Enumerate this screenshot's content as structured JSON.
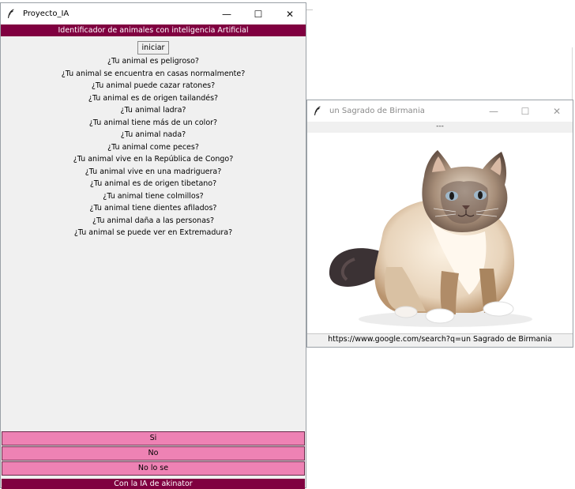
{
  "main_window": {
    "title": "Proyecto_IA",
    "header": "Identificador de animales con inteligencia Artificial",
    "start_label": "iniciar",
    "questions": [
      "¿Tu animal es peligroso?",
      "¿Tu animal se encuentra en casas normalmente?",
      "¿Tu animal puede cazar ratones?",
      "¿Tu animal es de origen tailandés?",
      "¿Tu animal ladra?",
      "¿Tu animal tiene más de un color?",
      "¿Tu animal nada?",
      "¿Tu animal come peces?",
      "¿Tu animal vive en la República de Congo?",
      "¿Tu animal vive en una madriguera?",
      "¿Tu animal es de origen tibetano?",
      "¿Tu animal tiene colmillos?",
      "¿Tu animal tiene dientes afilados?",
      "¿Tu animal daña a las personas?",
      "¿Tu animal se puede ver en Extremadura?"
    ],
    "answers": {
      "yes": "Si",
      "no": "No",
      "dont_know": "No lo se"
    },
    "footer": "Con la IA de akinator"
  },
  "image_window": {
    "title": "un Sagrado de Birmania",
    "top_text": "---",
    "url_text": "https://www.google.com/search?q=un Sagrado de Birmania"
  },
  "window_controls": {
    "minimize": "—",
    "maximize": "☐",
    "close": "✕"
  },
  "colors": {
    "accent": "#800040",
    "answer_button": "#ee82b4",
    "window_bg": "#f0f0f0"
  },
  "icons": {
    "app": "feather-icon",
    "image": "cat-photo"
  }
}
